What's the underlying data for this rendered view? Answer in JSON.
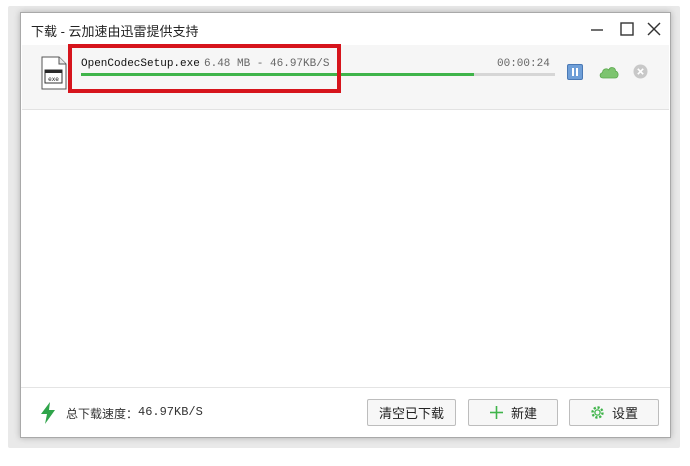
{
  "window": {
    "title": "下载 - 云加速由迅雷提供支持",
    "controls": [
      "minimize-icon",
      "maximize-icon",
      "close-icon"
    ]
  },
  "download": {
    "file_name": "OpenCodecSetup.exe",
    "size_speed": "6.48 MB - 46.97KB/S",
    "elapsed_time": "00:00:24",
    "progress": 0.83,
    "file_icon_text": "exe",
    "actions": [
      "pause-icon",
      "cloud-icon",
      "delete-icon"
    ],
    "highlight_color": "#d6141c"
  },
  "footer": {
    "speed_label": "总下载速度：",
    "speed_value": "46.97KB/S",
    "clear_button": "清空已下载",
    "new_button": "新建",
    "settings_button": "设置"
  },
  "colors": {
    "progress": "#3fb44a",
    "pause_button": "#6f9fd8",
    "cloud": "#7dc46f",
    "bolt": "#2fa44a"
  }
}
